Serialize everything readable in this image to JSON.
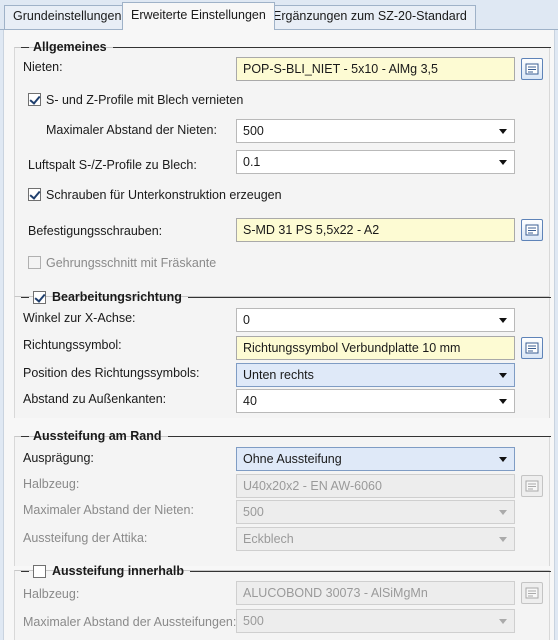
{
  "tabs": [
    {
      "label": "Grundeinstellungen",
      "active": false
    },
    {
      "label": "Erweiterte Einstellungen",
      "active": true
    },
    {
      "label": "Ergänzungen zum SZ-20-Standard",
      "active": false
    }
  ],
  "allgemeines": {
    "title": "Allgemeines",
    "nieten_label": "Nieten:",
    "nieten_value": "POP-S-BLI_NIET -  5x10 - AlMg 3,5",
    "sz_profile_checkbox": "S- und Z-Profile mit Blech vernieten",
    "sz_profile_checked": true,
    "max_abstand_label": "Maximaler Abstand der Nieten:",
    "max_abstand_value": "500",
    "luftspalt_label": "Luftspalt S-/Z-Profile zu Blech:",
    "luftspalt_value": "0.1",
    "schrauben_checkbox": "Schrauben für Unterkonstruktion erzeugen",
    "schrauben_checked": true,
    "befestigung_label": "Befestigungsschrauben:",
    "befestigung_value": "S-MD 31 PS 5,5x22 - A2",
    "gehrung_checkbox": "Gehrungsschnitt mit Fräskante",
    "gehrung_checked": false
  },
  "bearbeitung": {
    "title": "Bearbeitungsrichtung",
    "checked": true,
    "winkel_label": "Winkel zur X-Achse:",
    "winkel_value": "0",
    "symbol_label": "Richtungssymbol:",
    "symbol_value": "Richtungssymbol Verbundplatte 10 mm",
    "position_label": "Position des Richtungssymbols:",
    "position_value": "Unten rechts",
    "abstand_label": "Abstand zu Außenkanten:",
    "abstand_value": "40"
  },
  "aussteifung_rand": {
    "title": "Aussteifung am Rand",
    "auspraegung_label": "Ausprägung:",
    "auspraegung_value": "Ohne Aussteifung",
    "halbzeug_label": "Halbzeug:",
    "halbzeug_value": "U40x20x2 - EN AW-6060",
    "max_abstand_label": "Maximaler Abstand der Nieten:",
    "max_abstand_value": "500",
    "attika_label": "Aussteifung der Attika:",
    "attika_value": "Eckblech"
  },
  "aussteifung_innen": {
    "title": "Aussteifung innerhalb",
    "checked": false,
    "halbzeug_label": "Halbzeug:",
    "halbzeug_value": "ALUCOBOND 30073 - AlSiMgMn",
    "max_abstand_label": "Maximaler Abstand der Aussteifungen:",
    "max_abstand_value": "500"
  },
  "colors": {
    "input_yellow": "#fdfbd3",
    "selected_blue": "#dfe9f8",
    "tab_bg": "#dfe8f3"
  },
  "icons": {
    "catalog_button": "catalog-browse-icon"
  }
}
